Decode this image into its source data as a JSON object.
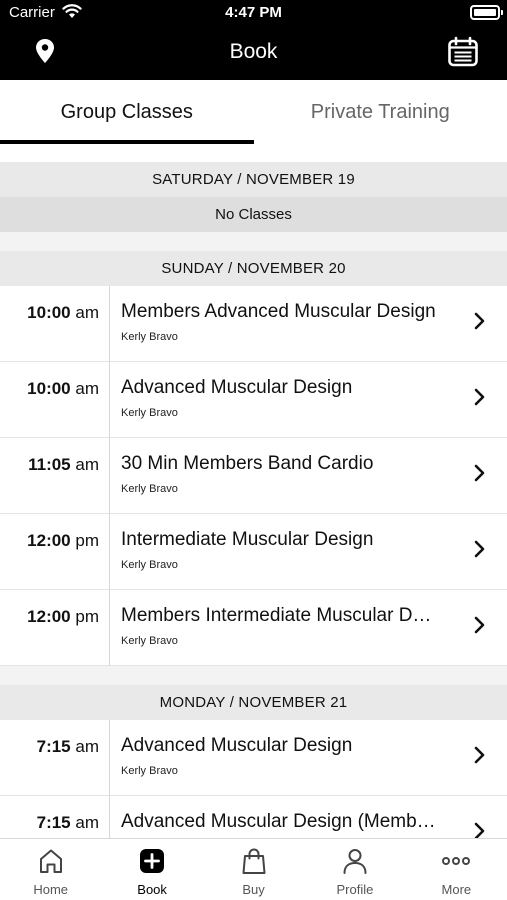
{
  "status": {
    "carrier": "Carrier",
    "time": "4:47 PM"
  },
  "nav": {
    "title": "Book"
  },
  "tabs": [
    {
      "label": "Group Classes",
      "active": true
    },
    {
      "label": "Private Training",
      "active": false
    }
  ],
  "days": [
    {
      "header": "SATURDAY / NOVEMBER 19",
      "empty_text": "No Classes",
      "classes": []
    },
    {
      "header": "SUNDAY / NOVEMBER 20",
      "classes": [
        {
          "time": "10:00",
          "ampm": "am",
          "title": "Members Advanced Muscular Design",
          "instructor": "Kerly Bravo"
        },
        {
          "time": "10:00",
          "ampm": "am",
          "title": "Advanced Muscular Design",
          "instructor": "Kerly Bravo"
        },
        {
          "time": "11:05",
          "ampm": "am",
          "title": "30 Min Members Band Cardio",
          "instructor": "Kerly Bravo"
        },
        {
          "time": "12:00",
          "ampm": "pm",
          "title": "Intermediate Muscular Design",
          "instructor": "Kerly Bravo"
        },
        {
          "time": "12:00",
          "ampm": "pm",
          "title": "Members Intermediate Muscular D…",
          "instructor": "Kerly Bravo"
        }
      ]
    },
    {
      "header": "MONDAY / NOVEMBER 21",
      "classes": [
        {
          "time": "7:15",
          "ampm": "am",
          "title": "Advanced Muscular Design",
          "instructor": "Kerly Bravo"
        },
        {
          "time": "7:15",
          "ampm": "am",
          "title": "Advanced Muscular Design (Memb…",
          "instructor": ""
        }
      ]
    }
  ],
  "bottom_tabs": [
    {
      "label": "Home",
      "icon": "home-icon"
    },
    {
      "label": "Book",
      "icon": "plus-square-icon",
      "active": true
    },
    {
      "label": "Buy",
      "icon": "shopping-bag-icon"
    },
    {
      "label": "Profile",
      "icon": "person-icon"
    },
    {
      "label": "More",
      "icon": "more-dots-icon"
    }
  ],
  "colors": {
    "nav_bg": "#000000",
    "section_bg": "#e9e9e9",
    "accent": "#000000"
  }
}
